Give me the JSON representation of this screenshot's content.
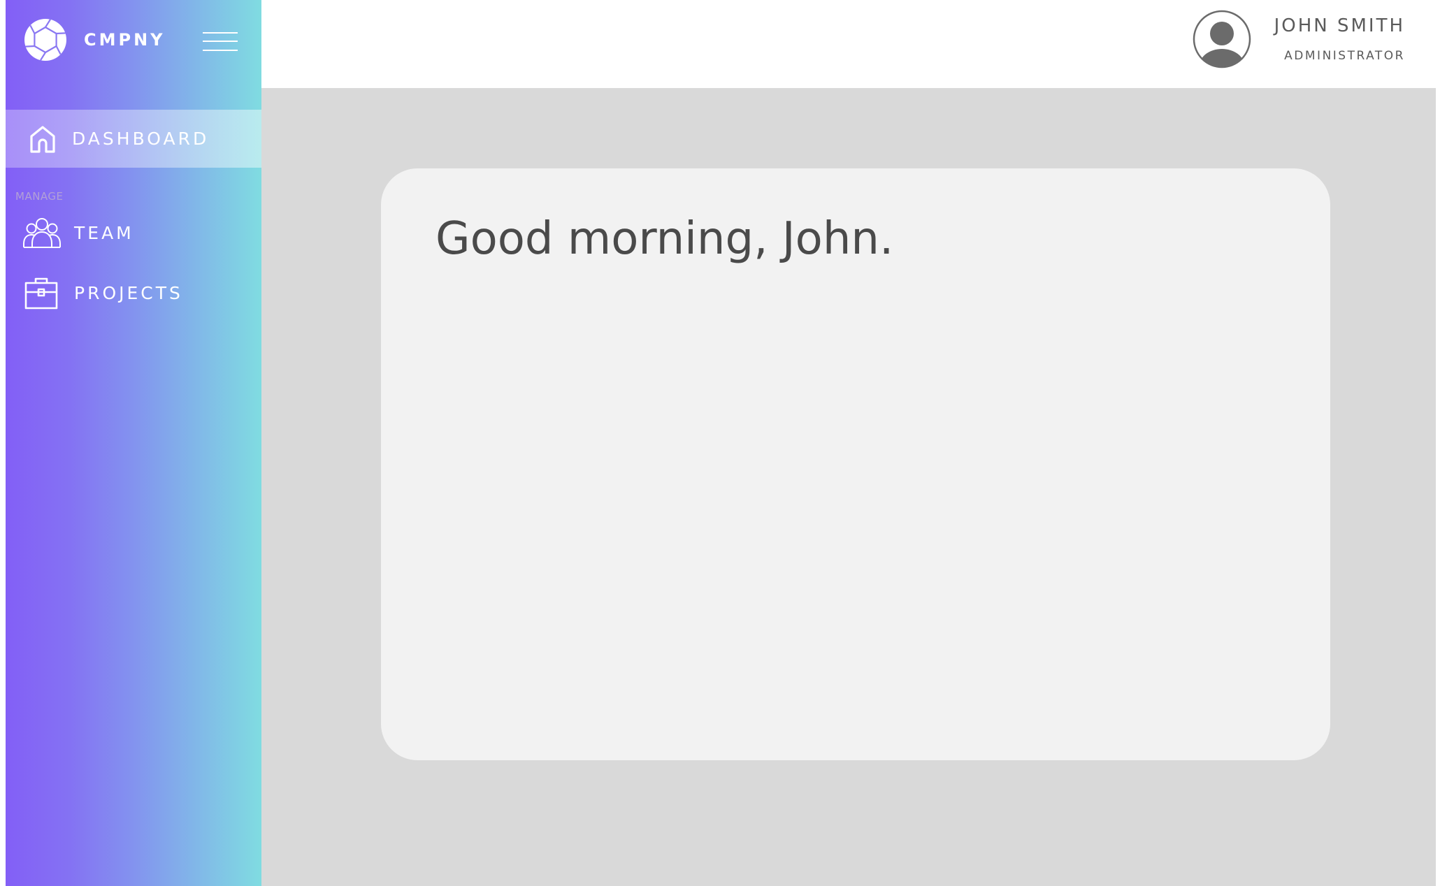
{
  "brand": {
    "name": "CMPNY",
    "logo_icon": "aperture-logo-icon"
  },
  "sidebar": {
    "menu_icon": "hamburger-menu-icon",
    "section_label": "MANAGE",
    "items": [
      {
        "label": "DASHBOARD",
        "icon": "home-icon",
        "active": true
      },
      {
        "label": "TEAM",
        "icon": "team-icon",
        "active": false
      },
      {
        "label": "PROJECTS",
        "icon": "briefcase-icon",
        "active": false
      }
    ],
    "gradient": [
      "#835ff6",
      "#80dce1"
    ]
  },
  "header": {
    "user": {
      "name": "JOHN SMITH",
      "role": "ADMINISTRATOR",
      "avatar_icon": "user-avatar-icon"
    }
  },
  "main": {
    "greeting": "Good morning, John."
  },
  "colors": {
    "background": "#d9d9d9",
    "card": "#f2f2f2",
    "text_dark": "#4a4a4a"
  }
}
